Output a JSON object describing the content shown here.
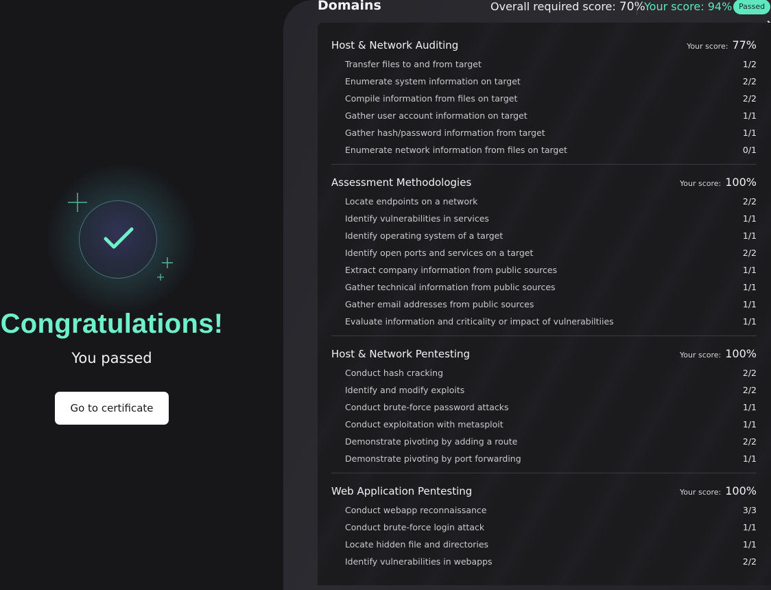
{
  "hero": {
    "title": "Congratulations!",
    "subtitle": "You passed",
    "button_label": "Go to certificate",
    "icon": "check-icon"
  },
  "header": {
    "title": "Domains",
    "required_label": "Overall required score:",
    "required_value": "70%",
    "your_label": "Your score:",
    "your_value": "94%",
    "badge": "Passed",
    "close_icon": "close-icon"
  },
  "colors": {
    "accent": "#5fe7bf",
    "congrats": "#6ef0c8",
    "background": "#17171a",
    "panel": "#26262b"
  },
  "score_label": "Your score:",
  "domains": [
    {
      "name": "Host & Network Auditing",
      "score": "77%",
      "items": [
        {
          "name": "Transfer files to and from target",
          "value": "1/2"
        },
        {
          "name": "Enumerate system information on target",
          "value": "2/2"
        },
        {
          "name": "Compile information from files on target",
          "value": "2/2"
        },
        {
          "name": "Gather user account information on target",
          "value": "1/1"
        },
        {
          "name": "Gather hash/password information from target",
          "value": "1/1"
        },
        {
          "name": "Enumerate network information from files on target",
          "value": "0/1"
        }
      ]
    },
    {
      "name": "Assessment Methodologies",
      "score": "100%",
      "items": [
        {
          "name": "Locate endpoints on a network",
          "value": "2/2"
        },
        {
          "name": "Identify vulnerabilities in services",
          "value": "1/1"
        },
        {
          "name": "Identify operating system of a target",
          "value": "1/1"
        },
        {
          "name": "Identify open ports and services on a target",
          "value": "2/2"
        },
        {
          "name": "Extract company information from public sources",
          "value": "1/1"
        },
        {
          "name": "Gather technical information from public sources",
          "value": "1/1"
        },
        {
          "name": "Gather email addresses from public sources",
          "value": "1/1"
        },
        {
          "name": "Evaluate information and criticality or impact of vulnerabiltiies",
          "value": "1/1"
        }
      ]
    },
    {
      "name": "Host & Network Pentesting",
      "score": "100%",
      "items": [
        {
          "name": "Conduct hash cracking",
          "value": "2/2"
        },
        {
          "name": "Identify and modify exploits",
          "value": "2/2"
        },
        {
          "name": "Conduct brute-force password attacks",
          "value": "1/1"
        },
        {
          "name": "Conduct exploitation with metasploit",
          "value": "1/1"
        },
        {
          "name": "Demonstrate pivoting by adding a route",
          "value": "2/2"
        },
        {
          "name": "Demonstrate pivoting by port forwarding",
          "value": "1/1"
        }
      ]
    },
    {
      "name": "Web Application Pentesting",
      "score": "100%",
      "items": [
        {
          "name": "Conduct webapp reconnaissance",
          "value": "3/3"
        },
        {
          "name": "Conduct brute-force login attack",
          "value": "1/1"
        },
        {
          "name": "Locate hidden file and directories",
          "value": "1/1"
        },
        {
          "name": "Identify vulnerabilities in webapps",
          "value": "2/2"
        }
      ]
    }
  ]
}
